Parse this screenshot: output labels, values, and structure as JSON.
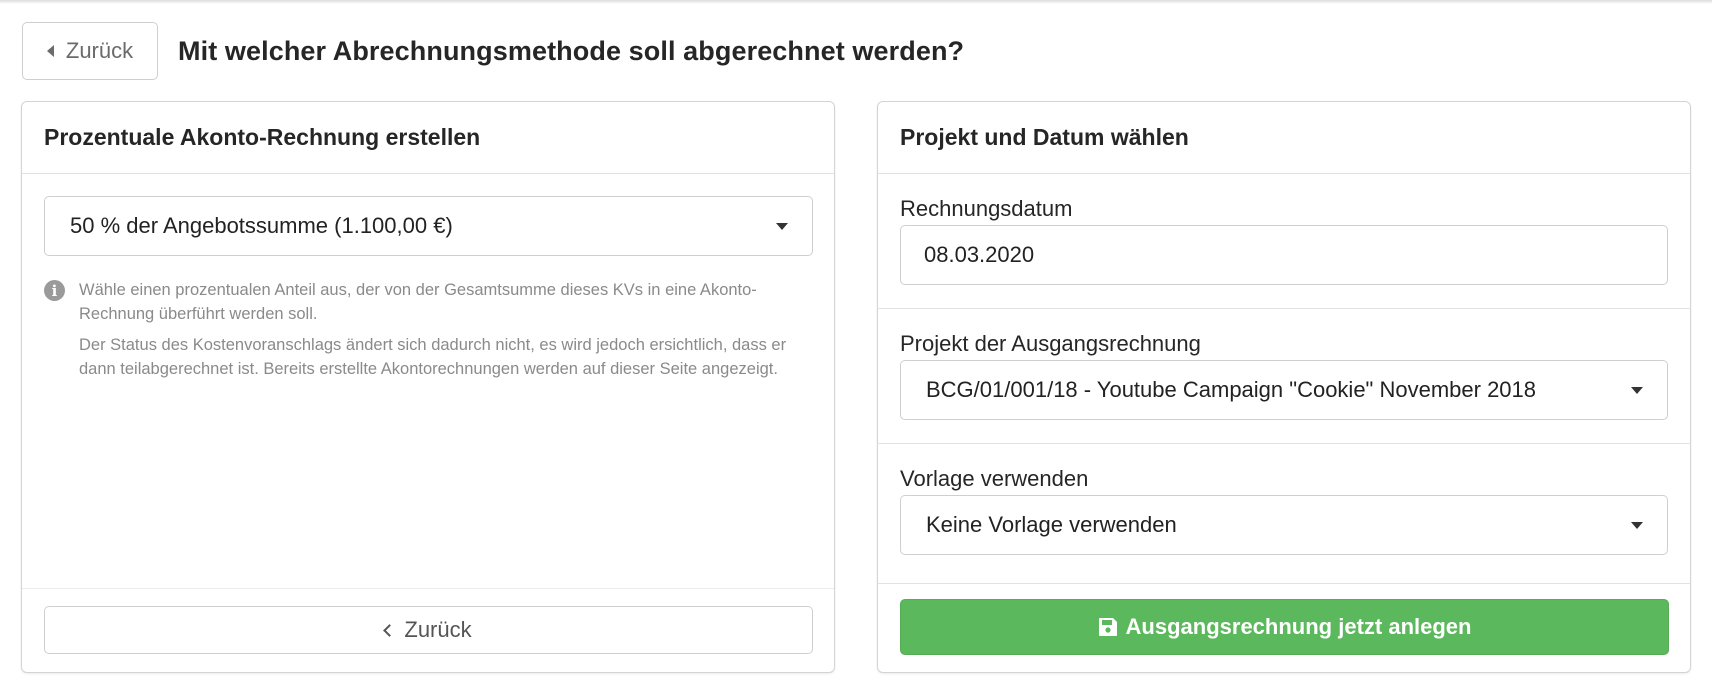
{
  "header": {
    "back_label": "Zurück",
    "title": "Mit welcher Abrechnungsmethode soll abgerechnet werden?"
  },
  "left_panel": {
    "title": "Prozentuale Akonto-Rechnung erstellen",
    "percent_select": {
      "value": "50 % der Angebotssumme (1.100,00 €)"
    },
    "help": {
      "icon": "info-icon",
      "paragraph_1": "Wähle einen prozentualen Anteil aus, der von der Gesamtsumme dieses KVs in eine Akonto-Rechnung überführt werden soll.",
      "paragraph_2": "Der Status des Kostenvoranschlags ändert sich dadurch nicht, es wird jedoch ersichtlich, dass er dann teilabgerechnet ist. Bereits erstellte Akontorechnungen werden auf dieser Seite angezeigt."
    },
    "back_label": "Zurück"
  },
  "right_panel": {
    "title": "Projekt und Datum wählen",
    "invoice_date": {
      "label": "Rechnungsdatum",
      "value": "08.03.2020"
    },
    "project": {
      "label": "Projekt der Ausgangsrechnung",
      "value": "BCG/01/001/18 - Youtube Campaign \"Cookie\" November 2018"
    },
    "template": {
      "label": "Vorlage verwenden",
      "value": "Keine Vorlage verwenden"
    },
    "submit_label": "Ausgangsrechnung jetzt anlegen",
    "submit_icon": "save-icon"
  },
  "colors": {
    "primary_green": "#5cb85c",
    "border": "#cfcfcf",
    "muted_text": "#8a8a8a"
  }
}
